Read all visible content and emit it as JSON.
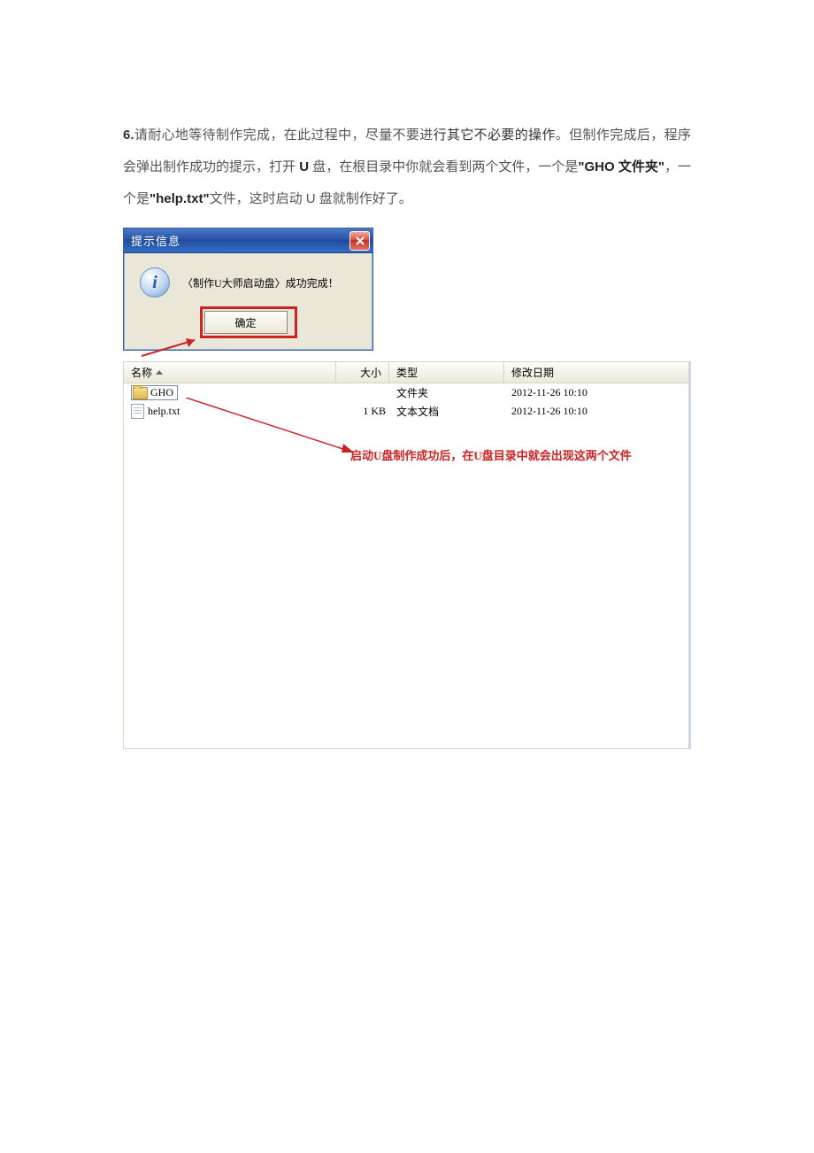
{
  "instruction": {
    "num": "6.",
    "t1": "请耐心地等待制作完成，在此过程中，尽量不要进",
    "t2": "行其它不必要的操作",
    "t3": "。但制作完成后，程序会弹出制作成功的提示，打开 ",
    "t4": "U",
    "t5": " 盘，在根目录中你就会看到两个文件，一个是",
    "t6": "\"GHO 文件夹\"",
    "t7": "，一个是",
    "t8": "\"help.txt\"",
    "t9": "文件，这时启动 U 盘就制作好了。"
  },
  "dialog": {
    "title": "提示信息",
    "message": "〈制作U大师启动盘〉成功完成！",
    "ok": "确定"
  },
  "explorer": {
    "headers": {
      "name": "名称",
      "size": "大小",
      "type": "类型",
      "date": "修改日期"
    },
    "rows": [
      {
        "name": "GHO",
        "size": "",
        "type": "文件夹",
        "date": "2012-11-26  10:10",
        "icon": "folder",
        "boxed": true
      },
      {
        "name": "help.txt",
        "size": "1 KB",
        "type": "文本文档",
        "date": "2012-11-26  10:10",
        "icon": "file",
        "boxed": false
      }
    ],
    "annotation": "启动U盘制作成功后，在U盘目录中就会出现这两个文件"
  }
}
